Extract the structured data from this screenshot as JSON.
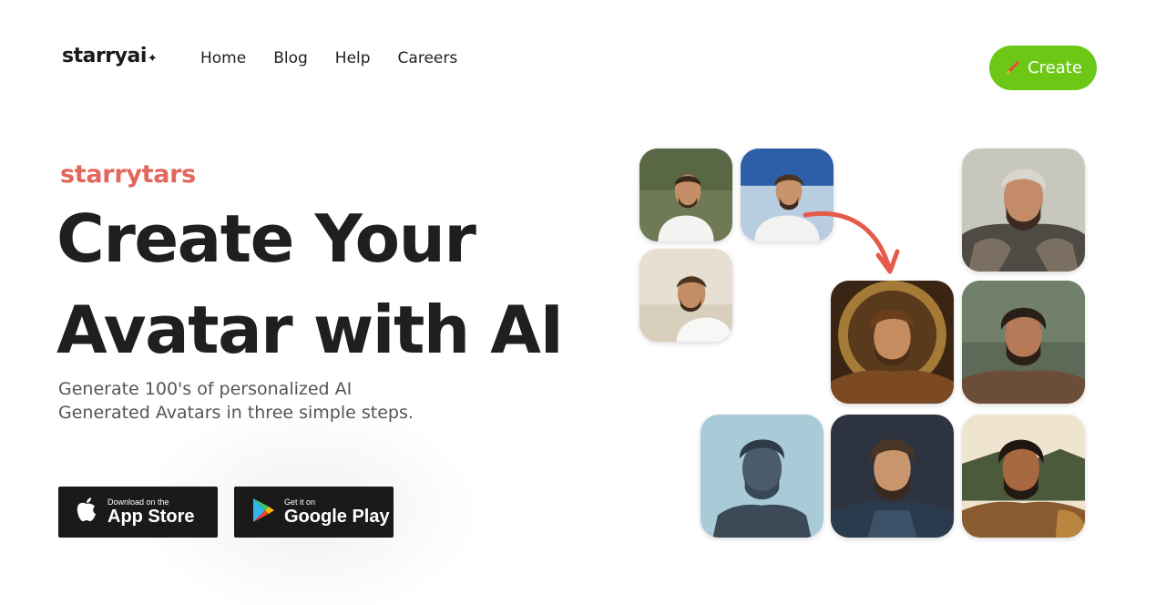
{
  "header": {
    "logo_text": "starryai",
    "logo_mark": "✦",
    "nav": [
      "Home",
      "Blog",
      "Help",
      "Careers"
    ],
    "create_label": "Create"
  },
  "hero": {
    "brand": "starrytars",
    "headline_line1": "Create Your",
    "headline_line2": "Avatar with AI",
    "subtitle": "Generate 100's of personalized AI Generated Avatars in three simple steps."
  },
  "stores": {
    "apple": {
      "small": "Download on the",
      "big": "App Store"
    },
    "google": {
      "small": "Get it on",
      "big": "Google Play"
    }
  },
  "gallery": {
    "input_photos": [
      "input-photo-1",
      "input-photo-2",
      "input-photo-3"
    ],
    "generated_avatars": [
      "avatar-warrior",
      "avatar-golden-halo",
      "avatar-forest",
      "avatar-statue",
      "avatar-comic",
      "avatar-gladiator"
    ]
  },
  "colors": {
    "accent_green": "#6cc814",
    "brand_coral": "#e2675c",
    "store_bg": "#1a1a1a"
  }
}
